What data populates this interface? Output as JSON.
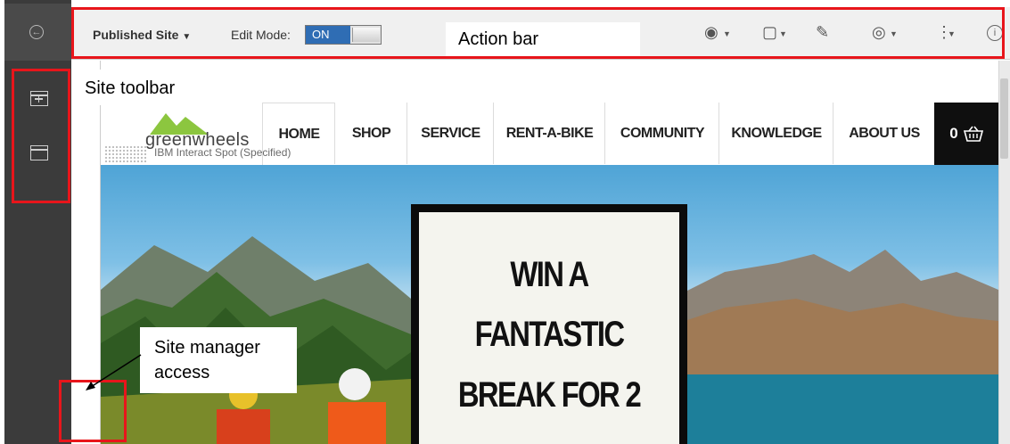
{
  "action_bar": {
    "site_selector": "Published Site",
    "edit_mode_label": "Edit Mode:",
    "edit_mode_value": "ON",
    "icons": [
      "globe-icon",
      "page-icon",
      "wrench-icon",
      "eye-icon",
      "more-icon",
      "info-icon"
    ]
  },
  "site_toolbar": {
    "icons": [
      "add-content-icon",
      "page-layout-icon"
    ]
  },
  "site": {
    "logo_text": "greenwheels",
    "spot_label": "IBM Interact Spot (Specified)",
    "nav": [
      "HOME",
      "SHOP",
      "SERVICE",
      "RENT-A-BIKE",
      "COMMUNITY",
      "KNOWLEDGE",
      "ABOUT US"
    ],
    "cart_count": "0",
    "promo_lines": [
      "WIN A",
      "FANTASTIC",
      "BREAK FOR 2"
    ]
  },
  "callouts": {
    "action_bar": "Action bar",
    "site_toolbar": "Site toolbar",
    "site_manager": "Site manager access"
  },
  "colors": {
    "highlight": "#e8151b",
    "toggle_on": "#2f6db4",
    "logo_green": "#8cc63f"
  }
}
